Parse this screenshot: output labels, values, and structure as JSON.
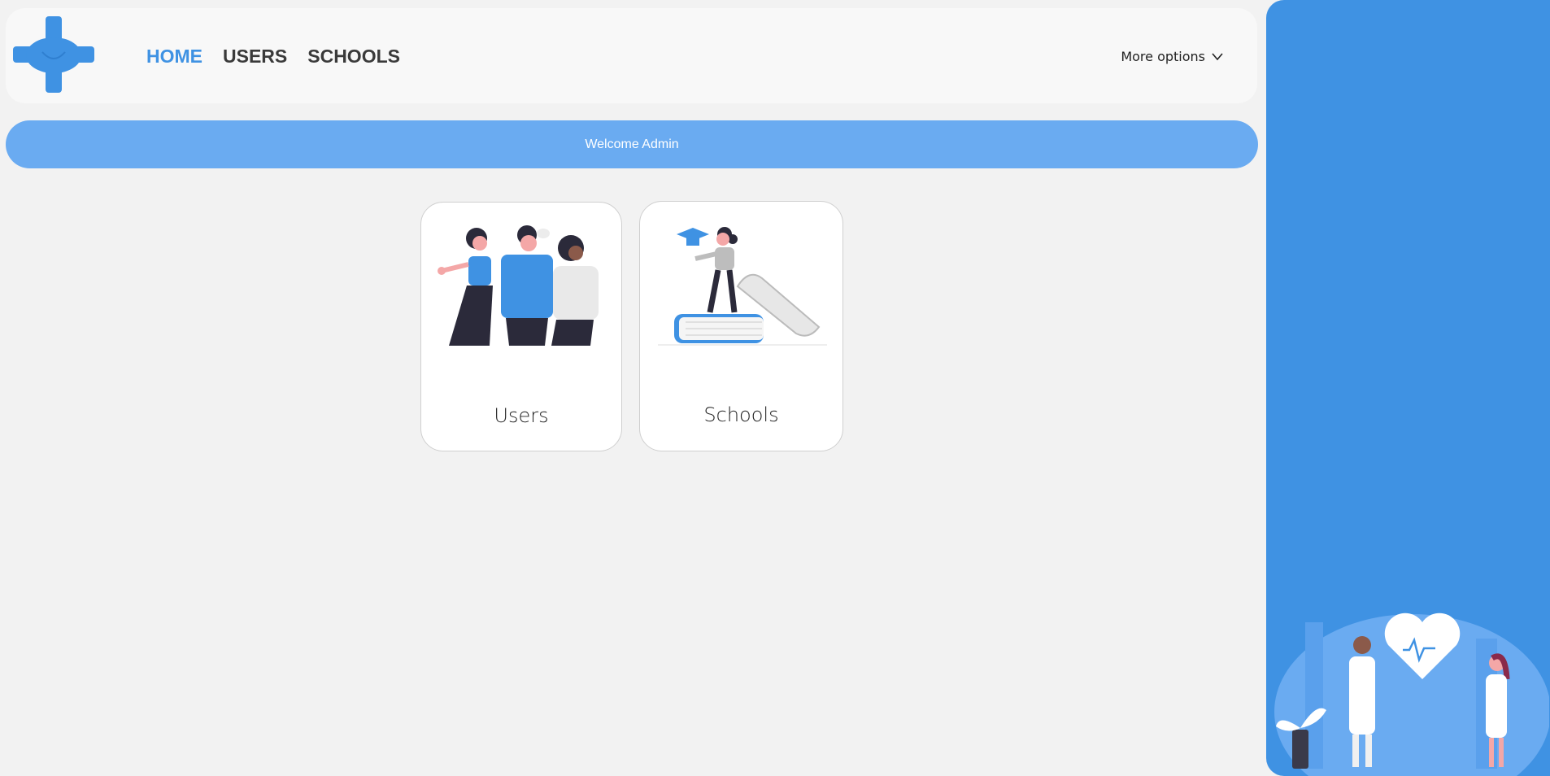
{
  "navbar": {
    "logo_icon": "medical-cross-heart-logo",
    "links": [
      {
        "label": "HOME",
        "active": true
      },
      {
        "label": "USERS",
        "active": false
      },
      {
        "label": "SCHOOLS",
        "active": false
      }
    ],
    "more_options_label": "More options",
    "more_options_icon": "chevron-down-icon"
  },
  "welcome": {
    "text": "Welcome Admin"
  },
  "cards": [
    {
      "label": "Users",
      "illustration": "people-group-illustration"
    },
    {
      "label": "Schools",
      "illustration": "student-on-books-illustration"
    }
  ],
  "side_panel": {
    "illustration": "doctors-heart-illustration"
  },
  "colors": {
    "accent": "#3f92e3",
    "banner": "#6aabf1",
    "background": "#f2f2f2"
  }
}
